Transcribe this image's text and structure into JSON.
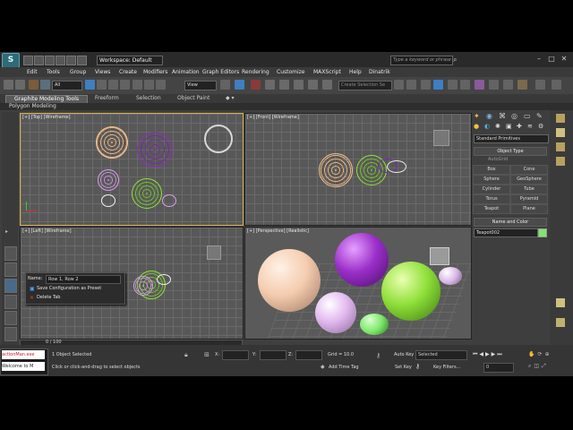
{
  "app": {
    "workspace": "Workspace: Default",
    "search_placeholder": "Type a keyword or phrase",
    "title_right_icons": [
      "minimize-icon",
      "maximize-icon",
      "close-icon"
    ]
  },
  "menus": [
    "Edit",
    "Tools",
    "Group",
    "Views",
    "Create",
    "Modifiers",
    "Animation",
    "Graph Editors",
    "Rendering",
    "Customize",
    "MAXScript",
    "Help",
    "Dinatrik"
  ],
  "toolbar": {
    "selection_filter": "All",
    "ref_coord": "View",
    "named_selection": "Create Selection Se"
  },
  "ribbon": {
    "tabs": [
      "Graphite Modeling Tools",
      "Freeform",
      "Selection",
      "Object Paint"
    ],
    "sub_label": "Polygon Modeling"
  },
  "viewports": {
    "top": "[+] [Top] [Wireframe]",
    "front": "[+] [Front] [Wireframe]",
    "left": "[+] [Left] [Wireframe]",
    "perspective": "[+] [Perspective] [Realistic]"
  },
  "context_menu": {
    "name_label": "Name:",
    "name_value": "Row 1, Row 2",
    "save_item": "Save Configuration as Preset",
    "delete_item": "Delete Tab"
  },
  "command_panel": {
    "category": "Standard Primitives",
    "object_type_header": "Object Type",
    "autogrid": "AutoGrid",
    "buttons": [
      "Box",
      "Cone",
      "Sphere",
      "GeoSphere",
      "Cylinder",
      "Tube",
      "Torus",
      "Pyramid",
      "Teapot",
      "Plane"
    ],
    "name_color_header": "Name and Color",
    "object_name": "Teapot002",
    "object_color": "#7ee86a"
  },
  "status": {
    "time_range": "0 / 100",
    "objects_selected": "1 Object Selected",
    "prompt": "Click or click-and-drag to select objects",
    "x_label": "X:",
    "y_label": "Y:",
    "z_label": "Z:",
    "grid": "Grid = 10.0",
    "add_time_tag": "Add Time Tag",
    "auto_key": "Auto Key",
    "key_mode": "Selected",
    "set_key": "Set Key",
    "key_filters": "Key Filters...",
    "frame": "0"
  },
  "listener": {
    "line1": "actionMan.exe",
    "line2": "Welcome to M"
  },
  "colors": {
    "accent_selection": "#d9b24d",
    "sphere_peach": "#f5cdb0",
    "sphere_purple": "#9b2fc9",
    "sphere_green": "#8fe03a",
    "sphere_lavender": "#e2b8ef",
    "teapot_green": "#7ee86a"
  }
}
